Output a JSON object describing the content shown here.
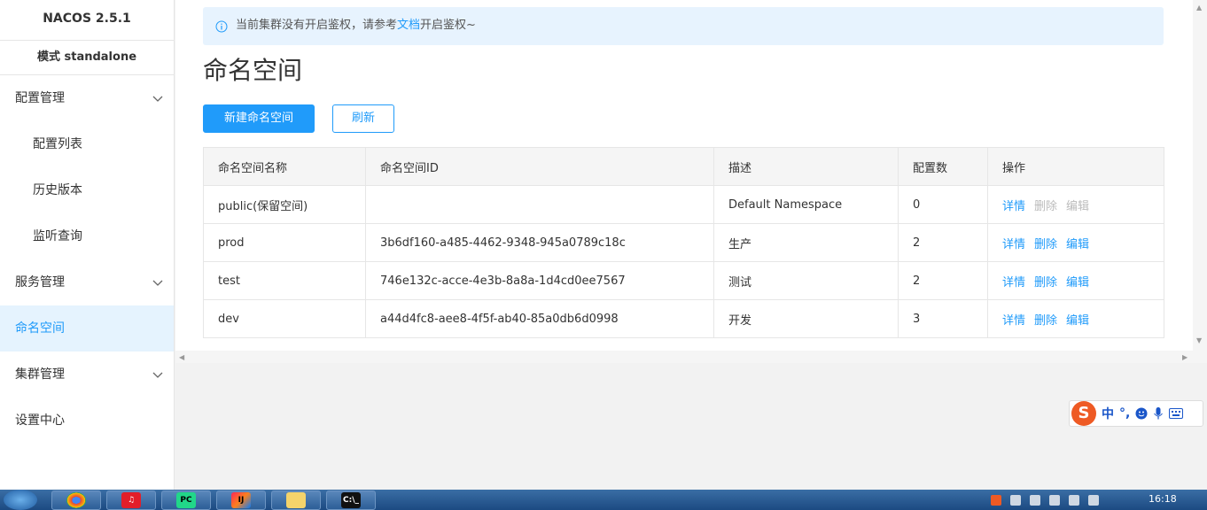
{
  "sidebar": {
    "brand": "NACOS 2.5.1",
    "mode": "模式 standalone",
    "items": [
      {
        "label": "配置管理",
        "type": "group"
      },
      {
        "label": "配置列表",
        "type": "sub"
      },
      {
        "label": "历史版本",
        "type": "sub"
      },
      {
        "label": "监听查询",
        "type": "sub"
      },
      {
        "label": "服务管理",
        "type": "group"
      },
      {
        "label": "命名空间",
        "type": "active"
      },
      {
        "label": "集群管理",
        "type": "group"
      },
      {
        "label": "设置中心",
        "type": "plain"
      }
    ]
  },
  "notice": {
    "prefix": "当前集群没有开启鉴权，请参考",
    "link": "文档",
    "suffix": "开启鉴权~"
  },
  "page": {
    "title": "命名空间",
    "new_button": "新建命名空间",
    "refresh_button": "刷新"
  },
  "table": {
    "columns": [
      "命名空间名称",
      "命名空间ID",
      "描述",
      "配置数",
      "操作"
    ],
    "rows": [
      {
        "name": "public(保留空间)",
        "id": "",
        "desc": "Default Namespace",
        "count": "0",
        "ops_disabled": true
      },
      {
        "name": "prod",
        "id": "3b6df160-a485-4462-9348-945a0789c18c",
        "desc": "生产",
        "count": "2",
        "ops_disabled": false
      },
      {
        "name": "test",
        "id": "746e132c-acce-4e3b-8a8a-1d4cd0ee7567",
        "desc": "测试",
        "count": "2",
        "ops_disabled": false
      },
      {
        "name": "dev",
        "id": "a44d4fc8-aee8-4f5f-ab40-85a0db6d0998",
        "desc": "开发",
        "count": "3",
        "ops_disabled": false
      }
    ],
    "actions": {
      "detail": "详情",
      "delete": "删除",
      "edit": "编辑"
    }
  },
  "ime": {
    "logo": "S",
    "lang": "中",
    "punct": "°,"
  },
  "taskbar": {
    "apps": [
      "chrome",
      "netease-music",
      "pycharm",
      "intellij",
      "explorer",
      "cmd"
    ],
    "app_labels": {
      "pycharm": "PC",
      "intellij": "IJ",
      "cmd": "C:\\_"
    },
    "clock": "16:18"
  },
  "colors": {
    "accent": "#209bfa",
    "active_bg": "#e5f3fe",
    "notice_bg": "#e7f3fe"
  }
}
